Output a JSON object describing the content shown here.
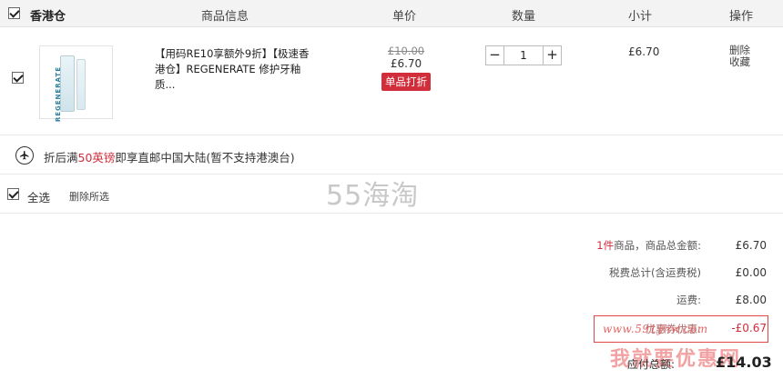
{
  "header": {
    "warehouse": "香港仓",
    "col_product": "商品信息",
    "col_price": "单价",
    "col_qty": "数量",
    "col_subtotal": "小计",
    "col_action": "操作"
  },
  "item": {
    "brand_on_image": "REGENERATE",
    "title": "【用码RE10享额外9折】【极速香港仓】REGENERATE 修护牙釉质...",
    "price_original": "£10.00",
    "price_current": "£6.70",
    "promo_tag": "单品打折",
    "quantity": "1",
    "qty_minus": "−",
    "qty_plus": "+",
    "subtotal": "£6.70",
    "action_delete": "删除",
    "action_collect": "收藏"
  },
  "shipping": {
    "prefix": "折后满",
    "highlight": "50英镑",
    "suffix": "即享直邮中国大陆(暂不支持港澳台)"
  },
  "footer": {
    "select_all": "全选",
    "delete_selected": "删除所选"
  },
  "summary": {
    "count": "1件",
    "goods_label": "商品，商品总金额:",
    "goods_value": "£6.70",
    "tax_label": "税费总计(含运费税)",
    "tax_value": "£0.00",
    "shipping_label": "运费:",
    "shipping_value": "£8.00",
    "coupon_label": "优惠券优惠:",
    "coupon_value": "-£0.67",
    "total_label": "应付总额:",
    "total_value": "£14.03"
  },
  "watermarks": {
    "site_55": "55海淘",
    "url": "www.591yhw.com",
    "brand": "我就要优惠网"
  },
  "colors": {
    "accent_red": "#d12d3b",
    "header_bg": "#f3f3f3"
  }
}
